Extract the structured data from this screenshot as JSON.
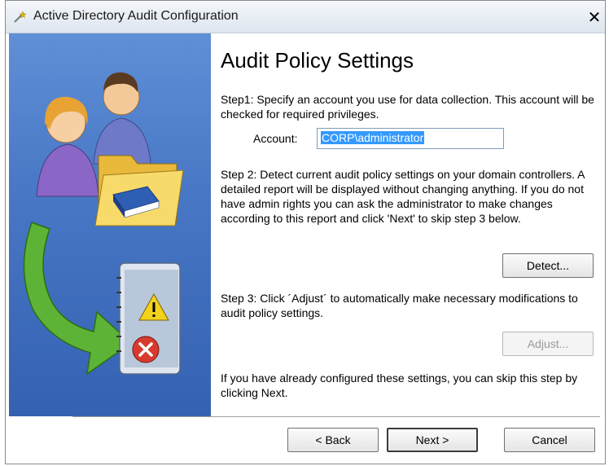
{
  "window": {
    "title": "Active Directory Audit Configuration",
    "close_label": "✕"
  },
  "main": {
    "heading": "Audit Policy Settings",
    "step1_text": "Step1: Specify an account you use for data collection. This account will be checked for required privileges.",
    "account_label": "Account:",
    "account_value": "CORP\\administrator",
    "step2_text": "Step 2: Detect current audit policy settings on your domain controllers. A detailed report will be displayed without changing anything. If you do not have admin rights you can ask the administrator to make changes according to this report and click 'Next' to skip step 3 below.",
    "detect_button": "Detect...",
    "step3_text": "Step 3: Click ´Adjust´ to automatically make necessary modifications to audit policy settings.",
    "adjust_button": "Adjust...",
    "skip_text": "If you have already configured these settings, you can skip this step by clicking Next."
  },
  "footer": {
    "back_button": "< Back",
    "next_button": "Next >",
    "cancel_button": "Cancel"
  },
  "icons": {
    "title": "wizard-wand-icon",
    "users": "users-icon",
    "folder": "folder-icon",
    "book": "book-icon",
    "arrow": "green-arrow-icon",
    "notebook": "notebook-icon",
    "warning": "warning-icon",
    "error": "error-icon"
  },
  "colors": {
    "side_panel": "#4676c4",
    "selection": "#3399ff",
    "arrow_green": "#5db335"
  }
}
